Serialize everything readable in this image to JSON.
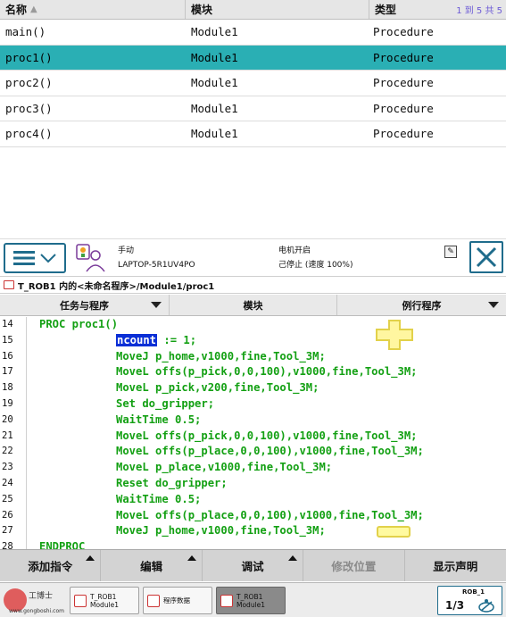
{
  "routine_list": {
    "headers": {
      "name": "名称",
      "module": "模块",
      "type": "类型"
    },
    "count_text": "1 到 5 共 5",
    "rows": [
      {
        "name": "main()",
        "module": "Module1",
        "type": "Procedure",
        "selected": false
      },
      {
        "name": "proc1()",
        "module": "Module1",
        "type": "Procedure",
        "selected": true
      },
      {
        "name": "proc2()",
        "module": "Module1",
        "type": "Procedure",
        "selected": false
      },
      {
        "name": "proc3()",
        "module": "Module1",
        "type": "Procedure",
        "selected": false
      },
      {
        "name": "proc4()",
        "module": "Module1",
        "type": "Procedure",
        "selected": false
      }
    ]
  },
  "header": {
    "mode": "手动",
    "controller": "LAPTOP-5R1UV4PO",
    "motor_state": "电机开启",
    "run_state": "己停止 (速度 100%)"
  },
  "breadcrumb": "T_ROB1 内的<未命名程序>/Module1/proc1",
  "tabs": [
    "任务与程序",
    "模块",
    "例行程序"
  ],
  "code_lines": [
    {
      "num": "14",
      "text": "PROC proc1()",
      "indent": 1
    },
    {
      "num": "15",
      "text": ":= 1;",
      "indent": 2,
      "highlight": "ncount"
    },
    {
      "num": "16",
      "text": "MoveJ p_home,v1000,fine,Tool_3M;",
      "indent": 2
    },
    {
      "num": "17",
      "text": "MoveL offs(p_pick,0,0,100),v1000,fine,Tool_3M;",
      "indent": 2
    },
    {
      "num": "18",
      "text": "MoveL p_pick,v200,fine,Tool_3M;",
      "indent": 2
    },
    {
      "num": "19",
      "text": "Set do_gripper;",
      "indent": 2
    },
    {
      "num": "20",
      "text": "WaitTime 0.5;",
      "indent": 2
    },
    {
      "num": "21",
      "text": "MoveL offs(p_pick,0,0,100),v1000,fine,Tool_3M;",
      "indent": 2
    },
    {
      "num": "22",
      "text": "MoveL offs(p_place,0,0,100),v1000,fine,Tool_3M;",
      "indent": 2
    },
    {
      "num": "23",
      "text": "MoveL p_place,v1000,fine,Tool_3M;",
      "indent": 2
    },
    {
      "num": "24",
      "text": "Reset do_gripper;",
      "indent": 2
    },
    {
      "num": "25",
      "text": "WaitTime 0.5;",
      "indent": 2
    },
    {
      "num": "26",
      "text": "MoveL offs(p_place,0,0,100),v1000,fine,Tool_3M;",
      "indent": 2
    },
    {
      "num": "27",
      "text": "MoveJ p_home,v1000,fine,Tool_3M;",
      "indent": 2
    },
    {
      "num": "28",
      "text": "ENDPROC",
      "indent": 1
    }
  ],
  "actions": [
    {
      "label": "添加指令",
      "has_menu": true,
      "disabled": false
    },
    {
      "label": "编辑",
      "has_menu": true,
      "disabled": false
    },
    {
      "label": "调试",
      "has_menu": true,
      "disabled": false
    },
    {
      "label": "修改位置",
      "has_menu": false,
      "disabled": true
    },
    {
      "label": "显示声明",
      "has_menu": false,
      "disabled": false
    }
  ],
  "taskbar": {
    "watermark_title": "工博士",
    "watermark_site": "www.gongboshi.com",
    "tasks": [
      {
        "label": "T_ROB1\nModule1",
        "active": false
      },
      {
        "label": "程序数据",
        "active": false
      },
      {
        "label": "T_ROB1\nModule1",
        "active": true
      }
    ],
    "rob_name": "ROB_1",
    "rob_fraction": "1/3"
  },
  "colors": {
    "selected_row": "#2aafb4",
    "code_text": "#13a013",
    "highlight": "#0b2fd6",
    "frame_blue": "#1f6c8c"
  },
  "icons": {
    "menu": "hamburger-menu-icon",
    "status": "robot-operator-icon",
    "close": "close-icon",
    "insert_marker": "plus-cursor-icon"
  }
}
